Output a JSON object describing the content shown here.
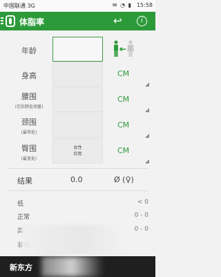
{
  "status_bar": {
    "carrier": "中国联通 3G",
    "time": "15:58",
    "icons": "✉ ◔ ▮"
  },
  "app": {
    "title": "体脂率"
  },
  "form": {
    "age_label": "年龄",
    "height_label": "身高",
    "waist_label": "腰围",
    "waist_sub": "(在肚脐处测量)",
    "neck_label": "颈围",
    "neck_sub": "(最窄处)",
    "hip_label": "臀围",
    "hip_sub": "(最宽处)",
    "hip_hint_line1": "女性",
    "hip_hint_line2": "仅用",
    "unit_height": "CM",
    "unit_waist": "CM",
    "unit_neck": "CM",
    "unit_hip": "CM"
  },
  "result": {
    "label": "结果",
    "value": "0.0",
    "unit": "Ø (♀)"
  },
  "ranges": [
    {
      "name": "低",
      "value": "< 0"
    },
    {
      "name": "正常",
      "value": "0 - 0"
    },
    {
      "name": "高",
      "value": "0 - 0"
    },
    {
      "name": "非常",
      "value": ""
    }
  ],
  "banner": {
    "text": "新东方"
  },
  "colors": {
    "accent": "#2d9a3a"
  }
}
